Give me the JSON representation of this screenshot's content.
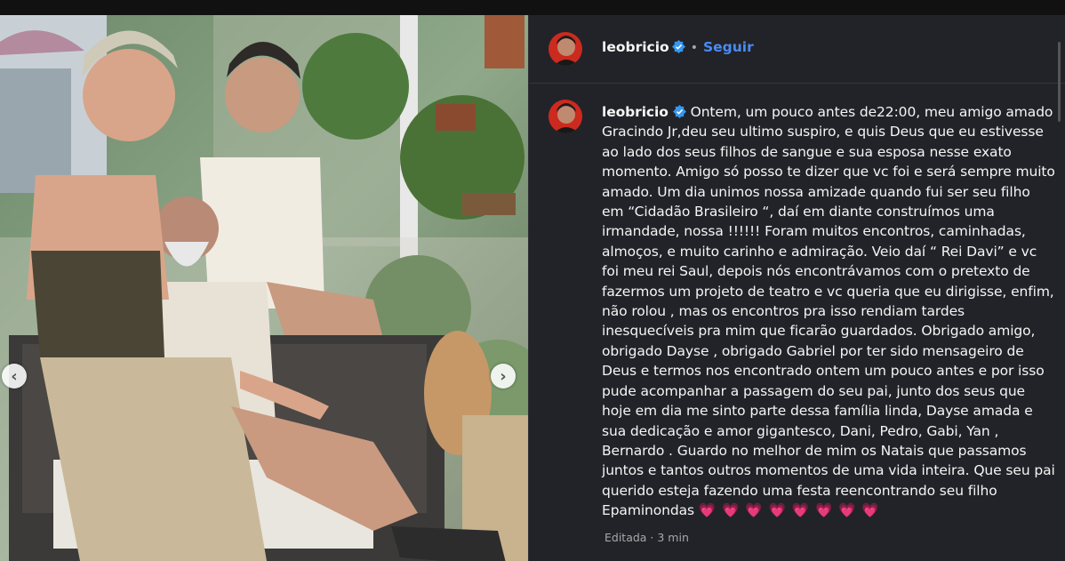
{
  "post": {
    "username": "leobricio",
    "follow_label": "Seguir",
    "separator": "•",
    "caption": "Ontem, um pouco antes de22:00, meu amigo amado Gracindo Jr,deu seu ultimo suspiro, e quis Deus que eu estivesse ao lado dos seus filhos de sangue e sua esposa nesse exato momento. Amigo só posso te dizer que vc foi e será sempre muito amado. Um dia unimos nossa amizade quando fui ser seu filho em “Cidadão Brasileiro “, daí em diante construímos uma irmandade, nossa !!!!!! Foram muitos encontros, caminhadas, almoços, e muito carinho e admiração. Veio daí “ Rei Davi” e vc foi meu rei Saul, depois nós encontrávamos com o pretexto de fazermos um projeto de teatro e vc queria que eu dirigisse, enfim, não rolou , mas os encontros pra isso rendiam tardes inesquecíveis pra mim que ficarão guardados. Obrigado amigo, obrigado Dayse , obrigado Gabriel por ter sido mensageiro de Deus e termos nos encontrado ontem um pouco antes e por isso pude acompanhar a passagem do seu pai, junto dos seus que hoje em dia me sinto parte dessa família linda, Dayse amada e sua dedicação e amor gigantesco, Dani, Pedro, Gabi, Yan , Bernardo . Guardo no melhor de mim os Natais que passamos juntos e tantos outros momentos de uma vida inteira. Que seu pai querido esteja fazendo uma festa reencontrando seu filho Epaminondas",
    "hearts": "💗 💗 💗 💗 💗 💗 💗 💗",
    "meta": "Editada · 3 min"
  },
  "icons": {
    "verified": "verified-badge-icon",
    "prev": "chevron-left-icon",
    "next": "chevron-right-icon"
  },
  "colors": {
    "panel_bg": "#212328",
    "follow": "#4a8bf5",
    "verified": "#3797f0",
    "heart": "#ff3040"
  }
}
